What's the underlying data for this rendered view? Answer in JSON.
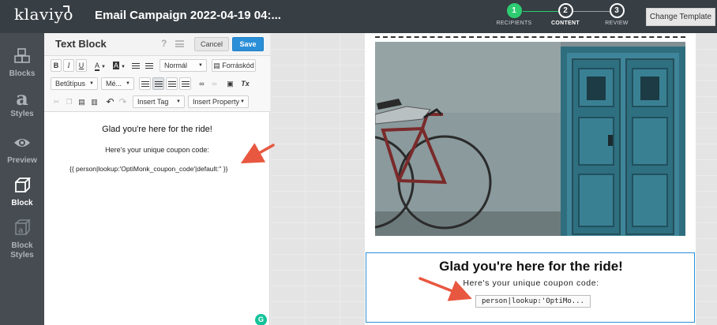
{
  "topbar": {
    "logo": "klaviyo",
    "campaign_title": "Email Campaign 2022-04-19 04:...",
    "steps": [
      {
        "number": "1",
        "label": "RECIPIENTS",
        "state": "done"
      },
      {
        "number": "2",
        "label": "CONTENT",
        "state": "active"
      },
      {
        "number": "3",
        "label": "REVIEW",
        "state": "pending"
      }
    ],
    "change_template_label": "Change Template"
  },
  "sidebar": {
    "items": [
      {
        "label": "Blocks",
        "icon": "blocks-icon"
      },
      {
        "label": "Styles",
        "icon": "styles-icon"
      },
      {
        "label": "Preview",
        "icon": "eye-icon"
      },
      {
        "label": "Block",
        "icon": "cube-icon",
        "active": true
      },
      {
        "label": "Block\nStyles",
        "icon": "block-styles-icon"
      }
    ]
  },
  "editor": {
    "title": "Text Block",
    "help": "?",
    "cancel_label": "Cancel",
    "save_label": "Save",
    "toolbar": {
      "bold": "B",
      "italic": "I",
      "underline": "U",
      "text_color": "A",
      "bg_color": "A",
      "format_select": "Normál",
      "source_label": "Forráskód",
      "font_select": "Betűtípus",
      "size_select": "Mé...",
      "insert_tag": "Insert Tag",
      "insert_property": "Insert Property",
      "clear_format": "Tx"
    },
    "content": {
      "heading": "Glad you're here for the ride!",
      "subheading": "Here's your unique coupon code:",
      "code": "{{ person|lookup:'OptiMonk_coupon_code'|default:'' }}"
    }
  },
  "preview": {
    "heading": "Glad you're here for the ride!",
    "subheading": "Here's your unique coupon code:",
    "code": "person|lookup:'OptiMo..."
  },
  "colors": {
    "topbar": "#373e44",
    "sidebar": "#464c52",
    "accent": "#2b8fd8",
    "step_done": "#2dcc70",
    "annotation_arrow": "#e8573f"
  }
}
